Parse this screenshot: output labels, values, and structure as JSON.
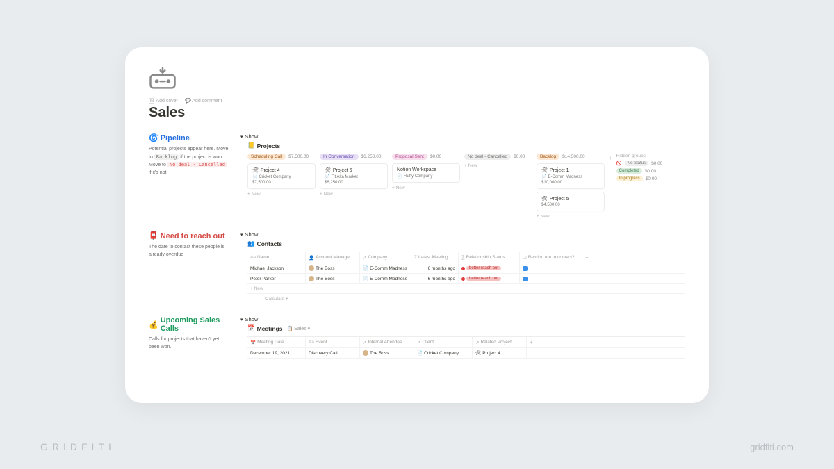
{
  "page": {
    "title": "Sales",
    "meta": {
      "add_cover": "Add cover",
      "add_comment": "Add comment"
    }
  },
  "pipeline": {
    "title": "Pipeline",
    "emoji": "🌀",
    "desc_parts": {
      "p1": "Potential projects appear here. Move to ",
      "backlog": "Backlog",
      "p2": " if the project is won.",
      "p3": "Move to ",
      "no_deal": "No deal - Cancelled",
      "p4": " if it's not."
    },
    "toggle": "Show",
    "db_title": "Projects",
    "db_emoji": "📒",
    "columns": [
      {
        "label": "Scheduling Call",
        "pill": "orange",
        "sum": "$7,500.00",
        "cards": [
          {
            "title": "Project 4",
            "emoji": "🛠",
            "sub": "Cricket Company",
            "sub_emoji": "📄",
            "val": "$7,500.00"
          }
        ]
      },
      {
        "label": "In Conversation",
        "pill": "purple",
        "sum": "$6,250.00",
        "cards": [
          {
            "title": "Project 6",
            "emoji": "🛠",
            "sub": "Fit Alta Market",
            "sub_emoji": "📄",
            "val": "$6,250.00"
          }
        ]
      },
      {
        "label": "Proposal Sent",
        "pill": "pink",
        "sum": "$0.00",
        "cards": [
          {
            "title": "Notion Workspace",
            "emoji": "",
            "sub": "Fluffy Company",
            "sub_emoji": "📄",
            "val": ""
          }
        ]
      },
      {
        "label": "No deal - Cancelled",
        "pill": "gray",
        "sum": "$0.00",
        "cards": []
      },
      {
        "label": "Backlog",
        "pill": "orange",
        "sum": "$14,500.00",
        "cards": [
          {
            "title": "Project 1",
            "emoji": "🛠",
            "sub": "E-Comm Madness",
            "sub_emoji": "📄",
            "val": "$10,000.00"
          },
          {
            "title": "Project 5",
            "emoji": "🛠",
            "sub": "",
            "sub_emoji": "",
            "val": "$4,500.00"
          }
        ]
      }
    ],
    "new": "+ New",
    "hidden_label": "Hidden groups",
    "hidden": [
      {
        "label": "No Status",
        "pill": "gray",
        "sum": "$0.00",
        "icon": "🚫"
      },
      {
        "label": "Completed",
        "pill": "green",
        "sum": "$0.00"
      },
      {
        "label": "In progress",
        "pill": "yellow",
        "sum": "$0.00"
      }
    ]
  },
  "reach": {
    "emoji": "📮",
    "title": "Need to reach out",
    "desc": "The date to contact these people is already overdue",
    "toggle": "Show",
    "db_title": "Contacts",
    "db_emoji": "👥",
    "headers": [
      "Name",
      "Account Manager",
      "Company",
      "Latest Meeting",
      "Relationship Status",
      "Remind me to contact?"
    ],
    "rows": [
      {
        "name": "Michael Jackson",
        "manager": "The Boss",
        "company": "E-Comm Madness",
        "latest": "6 months ago",
        "status": "better reach out",
        "remind": true
      },
      {
        "name": "Peter Parker",
        "manager": "The Boss",
        "company": "E-Comm Madness",
        "latest": "6 months ago",
        "status": "better reach out",
        "remind": true
      }
    ],
    "new": "+ New",
    "calc": "Calculate ▾"
  },
  "calls": {
    "emoji": "💰",
    "title": "Upcoming Sales Calls",
    "desc": "Calls for projects that haven't yet been won.",
    "toggle": "Show",
    "db_title": "Meetings",
    "db_emoji": "📅",
    "view_label": "Sales ▾",
    "headers": [
      "Meeting Date",
      "Event",
      "Internal Attendee",
      "Client",
      "Related Project"
    ],
    "rows": [
      {
        "date": "December 19, 2021",
        "event": "Discovery Call",
        "attendee": "The Boss",
        "client": "Cricket Company",
        "project": "Project 4"
      }
    ]
  },
  "footer": {
    "left": "GRIDFITI",
    "right": "gridfiti.com"
  }
}
